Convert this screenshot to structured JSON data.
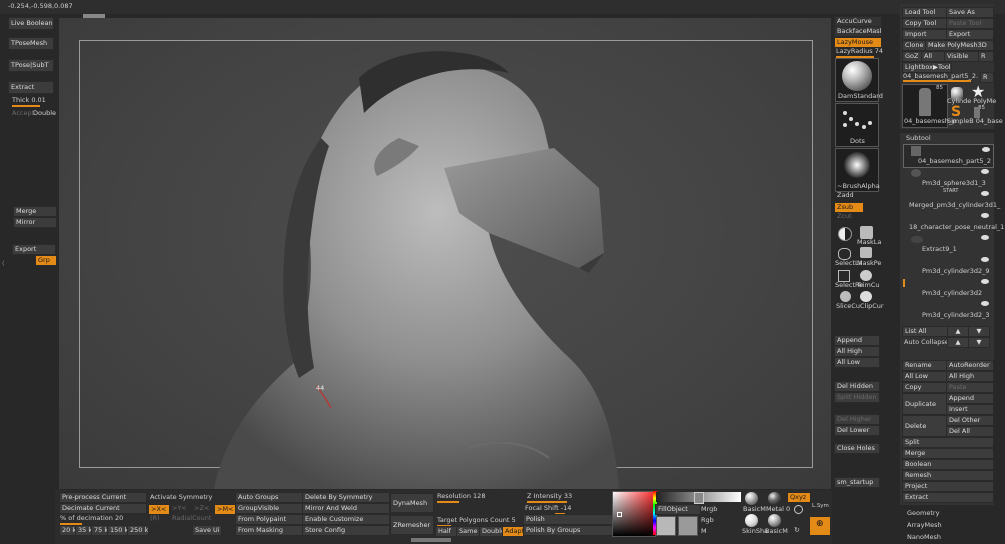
{
  "coords": "-0.254,-0.598,0.087",
  "left_panel": {
    "live_boolean": "Live Boolean",
    "tpose_mesh": "TPoseMesh",
    "tpose_subt": "TPose|SubT",
    "extract": "Extract",
    "thick_label": "Thick",
    "thick_value": "0.01",
    "accept": "Accept",
    "double": "Double",
    "merge": "Merge",
    "mirror": "Mirror",
    "export": "Export",
    "grp": "Grp"
  },
  "viewport": {
    "annotation": "44"
  },
  "brush_shelf": {
    "accucurve": "AccuCurve",
    "backface_mask": "BackfaceMask",
    "lazy_mouse": "LazyMouse",
    "lazy_radius_label": "LazyRadius",
    "lazy_radius_value": "74",
    "dam_standard": "DamStandard",
    "dots": "Dots",
    "brush_alpha": "~BrushAlpha",
    "zadd": "Zadd",
    "zsub": "Zsub",
    "zcut": "Zcut",
    "mask_la": "MaskLa",
    "select_lasso": "SelectLa",
    "mask_pe": "MaskPe",
    "select_rect": "SelectRe",
    "trim_curve": "TrimCu",
    "slice_curve": "SliceCu",
    "clip_curve": "ClipCur"
  },
  "tool_panel": {
    "load_tool": "Load Tool",
    "save_as": "Save As",
    "copy_tool": "Copy Tool",
    "paste_tool": "Paste Tool",
    "import": "Import",
    "export": "Export",
    "clone": "Clone",
    "make_polymesh": "Make PolyMesh3D",
    "goz": "GoZ",
    "all": "All",
    "visible": "Visible",
    "r": "R",
    "lightbox_tools": "Lightbox▶Tools",
    "current_tool": "04_basemesh_part5_2.",
    "current_tool_count": "48",
    "thumb_count": "85",
    "thumb_count2": "85",
    "thumb_mesh_name": "04_basemesh_p",
    "thumb_cylinder": "Cylinde PolyMe",
    "thumb_simple": "SimpleB 04_base",
    "thumb_s": "S"
  },
  "subtool": {
    "header": "Subtool",
    "items": [
      "04_basemesh_part5_2",
      "Pm3d_sphere3d1_3",
      "Merged_pm3d_cylinder3d1_",
      "18_character_pose_neutral_1",
      "Extract9_1",
      "Pm3d_cylinder3d2_9",
      "Pm3d_cylinder3d2",
      "Pm3d_cylinder3d2_3"
    ],
    "start_marker": "START",
    "list_all": "List All",
    "auto_collapse": "Auto Collapse",
    "rename": "Rename",
    "auto_reorder": "AutoReorder",
    "all_low": "All Low",
    "all_high": "All High",
    "copy": "Copy",
    "paste": "Paste",
    "append": "Append",
    "duplicate": "Duplicate",
    "insert": "Insert",
    "delete": "Delete",
    "del_other": "Del Other",
    "del_all": "Del All",
    "split": "Split",
    "merge": "Merge",
    "boolean": "Boolean",
    "remesh": "Remesh",
    "project": "Project",
    "extract": "Extract",
    "geometry": "Geometry",
    "arraymesh": "ArrayMesh",
    "nanomesh": "NanoMesh"
  },
  "mid_panel": {
    "append": "Append",
    "all_high": "All High",
    "all_low": "All Low",
    "del_hidden": "Del Hidden",
    "split_hidden": "Split Hidden",
    "del_higher": "Del Higher",
    "del_lower": "Del Lower",
    "close_holes": "Close Holes",
    "sm_startup": "sm_startup"
  },
  "bottom_bar": {
    "preprocess_current": "Pre-process Current",
    "decimate_current": "Decimate Current",
    "pct_decimation_label": "% of decimation",
    "pct_decimation_value": "20",
    "presets": [
      "20 k",
      "35 k",
      "75 k",
      "150 k",
      "250 k"
    ],
    "activate_symmetry": "Activate Symmetry",
    "sym_x": ">X<",
    "sym_y": ">Y<",
    "sym_z": ">Z<",
    "sym_m": ">M<",
    "radial_r": "(R)",
    "radial_count": "RadialCount",
    "save_ui": "Save Ui",
    "auto_groups": "Auto Groups",
    "group_visible": "GroupVisible",
    "from_polypaint": "From Polypaint",
    "from_masking": "From Masking",
    "delete_by_symmetry": "Delete By Symmetry",
    "mirror_and_weld": "Mirror And Weld",
    "enable_customize": "Enable Customize",
    "store_config": "Store Config",
    "dynamesh": "DynaMesh",
    "zremesher": "ZRemesher",
    "resolution_label": "Resolution",
    "resolution_value": "128",
    "target_polygons_label": "Target Polygons Count",
    "target_polygons_value": "5",
    "half": "Half",
    "same": "Same",
    "double": "Double",
    "adapt": "Adapt",
    "z_intensity_label": "Z Intensity",
    "z_intensity_value": "33",
    "focal_shift_label": "Focal Shift",
    "focal_shift_value": "-14",
    "polish": "Polish",
    "polish_by_groups": "Polish By Groups",
    "fill_object": "FillObject",
    "mrgb": "Mrgb",
    "rgb": "Rgb",
    "m": "M",
    "basic_mat": "BasicM",
    "metal": "Metal 0",
    "skin_shade": "SkinSha",
    "basic_mat2": "BasicM",
    "qxyz": "Qxyz",
    "lsym": "L.Sym"
  },
  "colors": {
    "accent": "#e38a17",
    "panel": "#333333",
    "background": "#282828"
  }
}
